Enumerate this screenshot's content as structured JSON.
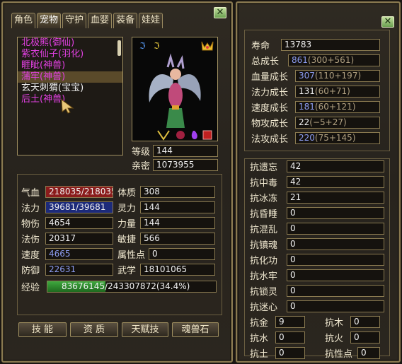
{
  "tabs": [
    "角色",
    "宠物",
    "守护",
    "血婴",
    "装备",
    "娃娃"
  ],
  "active_tab_index": 1,
  "pets": [
    {
      "name": "北极熊(御仙)"
    },
    {
      "name": "紫衣仙子(羽化)"
    },
    {
      "name": "睚眦(神兽)"
    },
    {
      "name": "蒲牢(神兽)"
    },
    {
      "name": "玄天刺猬(宝宝)"
    },
    {
      "name": "后土(神兽)"
    }
  ],
  "selected_pet_index": 3,
  "close_symbol": "✕",
  "level": {
    "label": "等级",
    "value": "144"
  },
  "intimacy": {
    "label": "亲密",
    "value": "1073955"
  },
  "stats": {
    "hp": {
      "label": "气血",
      "value": "218035/218035"
    },
    "mp": {
      "label": "法力",
      "value": "39681/39681"
    },
    "phys_atk": {
      "label": "物伤",
      "value": "4654"
    },
    "mag_atk": {
      "label": "法伤",
      "value": "20317"
    },
    "speed": {
      "label": "速度",
      "value": "4665"
    },
    "defense": {
      "label": "防御",
      "value": "22631"
    },
    "constitution": {
      "label": "体质",
      "value": "308"
    },
    "spirit": {
      "label": "灵力",
      "value": "144"
    },
    "strength": {
      "label": "力量",
      "value": "144"
    },
    "agility": {
      "label": "敏捷",
      "value": "566"
    },
    "attr_points": {
      "label": "属性点",
      "value": "0"
    },
    "martial": {
      "label": "武学",
      "value": "18101065"
    }
  },
  "exp": {
    "label": "经验",
    "text": "83676145/243307872(34.4%)",
    "percent": 34.4
  },
  "buttons": [
    "技 能",
    "资 质",
    "天赋技",
    "魂兽石"
  ],
  "growth": [
    {
      "label": "寿命",
      "value": "13783",
      "extra": ""
    },
    {
      "label": "总成长",
      "value": "861",
      "extra": "(300+561)"
    },
    {
      "label": "血量成长",
      "value": "307",
      "extra": "(110+197)"
    },
    {
      "label": "法力成长",
      "value": "131",
      "extra": "(60+71)"
    },
    {
      "label": "速度成长",
      "value": "181",
      "extra": "(60+121)"
    },
    {
      "label": "物攻成长",
      "value": "22",
      "extra": "(−5+27)"
    },
    {
      "label": "法攻成长",
      "value": "220",
      "extra": "(75+145)"
    }
  ],
  "resists": [
    {
      "label": "抗遗忘",
      "value": "42"
    },
    {
      "label": "抗中毒",
      "value": "42"
    },
    {
      "label": "抗冰冻",
      "value": "21"
    },
    {
      "label": "抗昏睡",
      "value": "0"
    },
    {
      "label": "抗混乱",
      "value": "0"
    },
    {
      "label": "抗镇魂",
      "value": "0"
    },
    {
      "label": "抗化功",
      "value": "0"
    },
    {
      "label": "抗水牢",
      "value": "0"
    },
    {
      "label": "抗锁灵",
      "value": "0"
    },
    {
      "label": "抗迷心",
      "value": "0"
    }
  ],
  "elements": [
    {
      "label": "抗金",
      "value": "9"
    },
    {
      "label": "抗木",
      "value": "0"
    },
    {
      "label": "抗水",
      "value": "0"
    },
    {
      "label": "抗火",
      "value": "0"
    },
    {
      "label": "抗土",
      "value": "0"
    },
    {
      "label": "抗性点",
      "value": "0"
    }
  ]
}
